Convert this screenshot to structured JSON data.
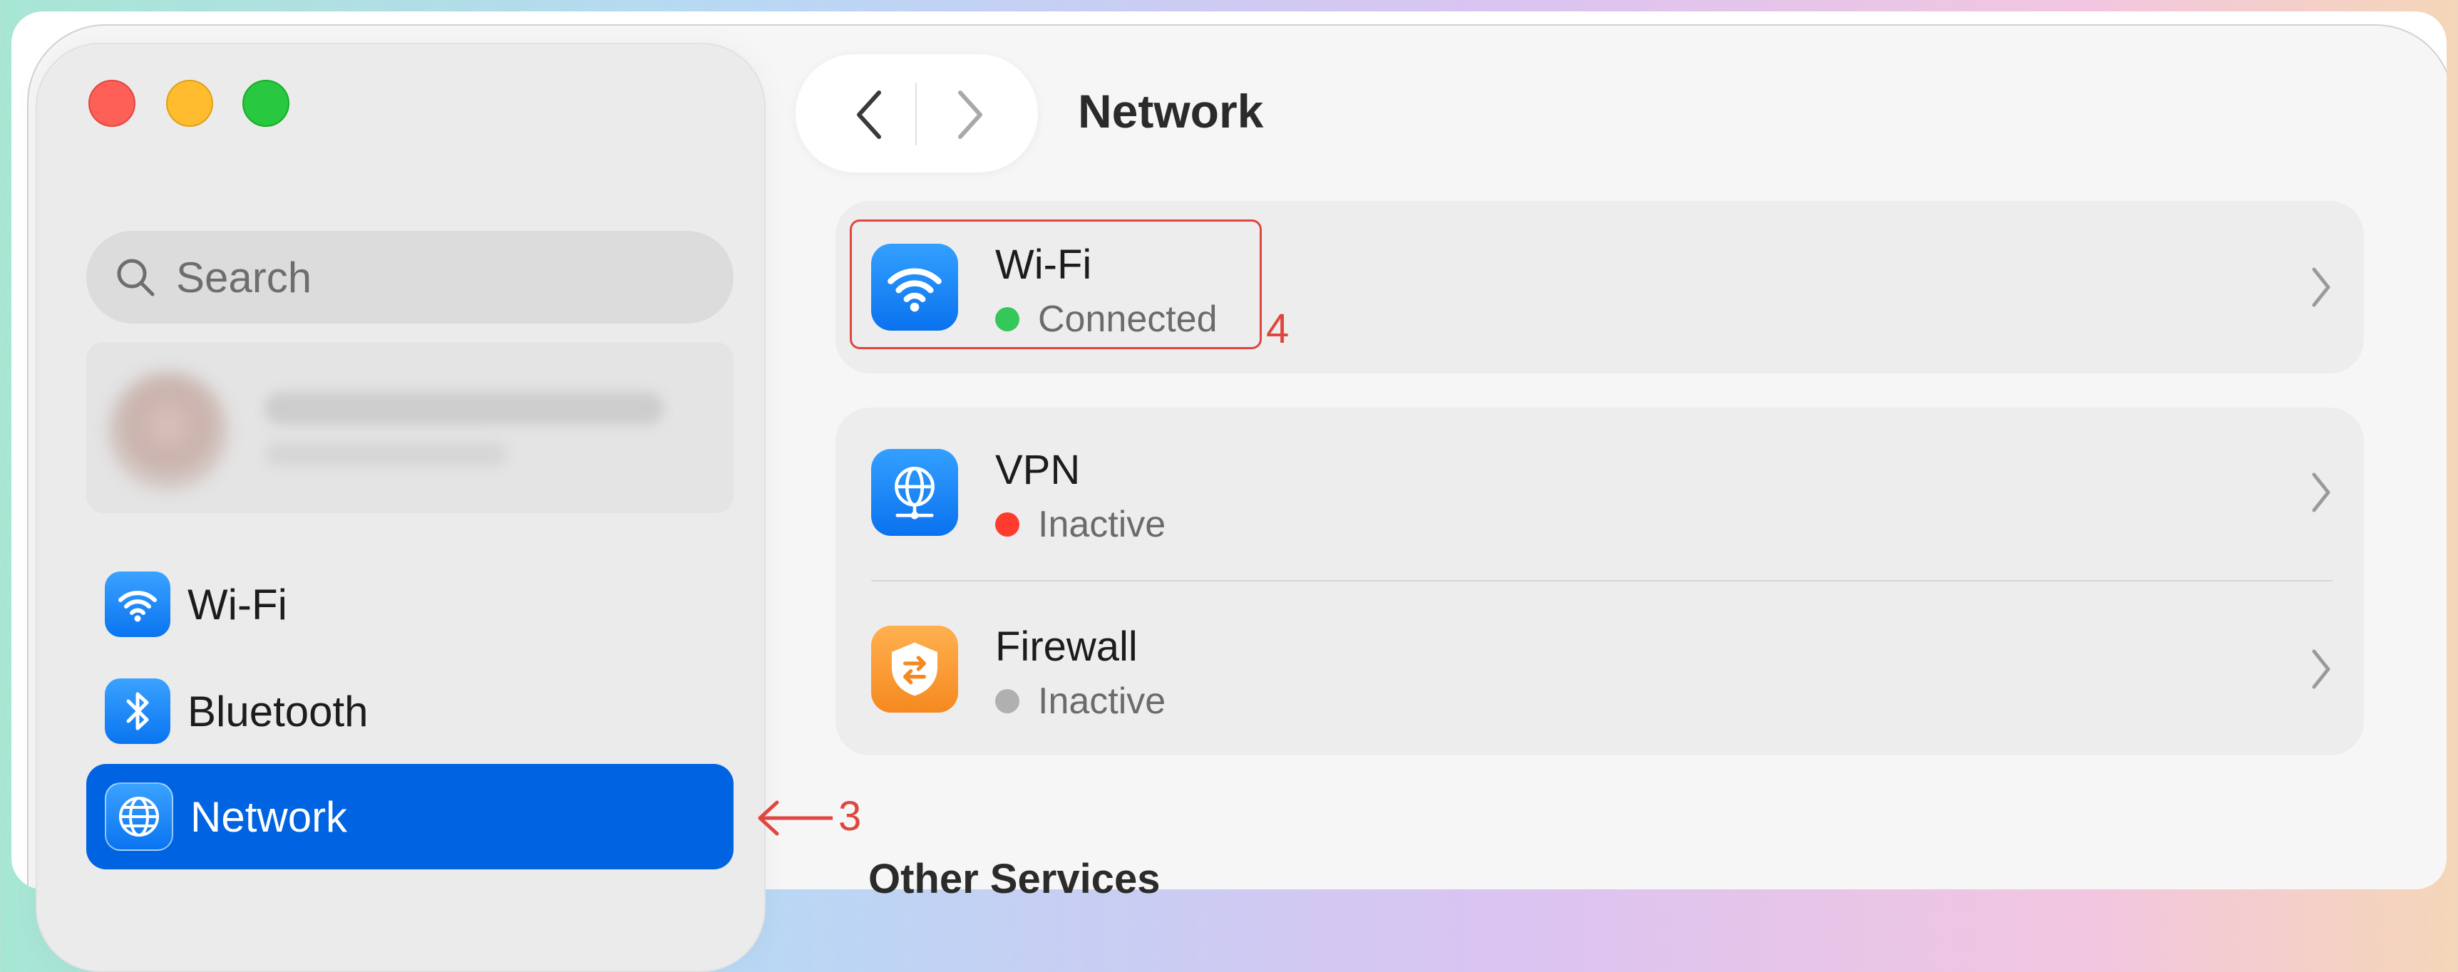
{
  "window": {
    "title": "Network",
    "traffic_lights": [
      "close",
      "minimize",
      "zoom"
    ]
  },
  "sidebar": {
    "search_placeholder": "Search",
    "account_blurred": true,
    "items": [
      {
        "label": "Wi-Fi",
        "icon": "wifi-icon",
        "selected": false
      },
      {
        "label": "Bluetooth",
        "icon": "bluetooth-icon",
        "selected": false
      },
      {
        "label": "Network",
        "icon": "globe-icon",
        "selected": true
      }
    ]
  },
  "main": {
    "services": [
      {
        "title": "Wi-Fi",
        "status": "Connected",
        "status_color": "#34c759",
        "icon": "wifi-icon"
      },
      {
        "title": "VPN",
        "status": "Inactive",
        "status_color": "#ff3b30",
        "icon": "vpn-globe-icon"
      },
      {
        "title": "Firewall",
        "status": "Inactive",
        "status_color": "#b0b0b0",
        "icon": "firewall-shield-icon"
      }
    ],
    "other_services_heading": "Other Services"
  },
  "annotations": {
    "network_step": "3",
    "wifi_step": "4",
    "color": "#e0463f"
  },
  "colors": {
    "accent": "#0063e1",
    "sidebar_bg": "#ebebeb",
    "card_bg": "#ededed"
  }
}
